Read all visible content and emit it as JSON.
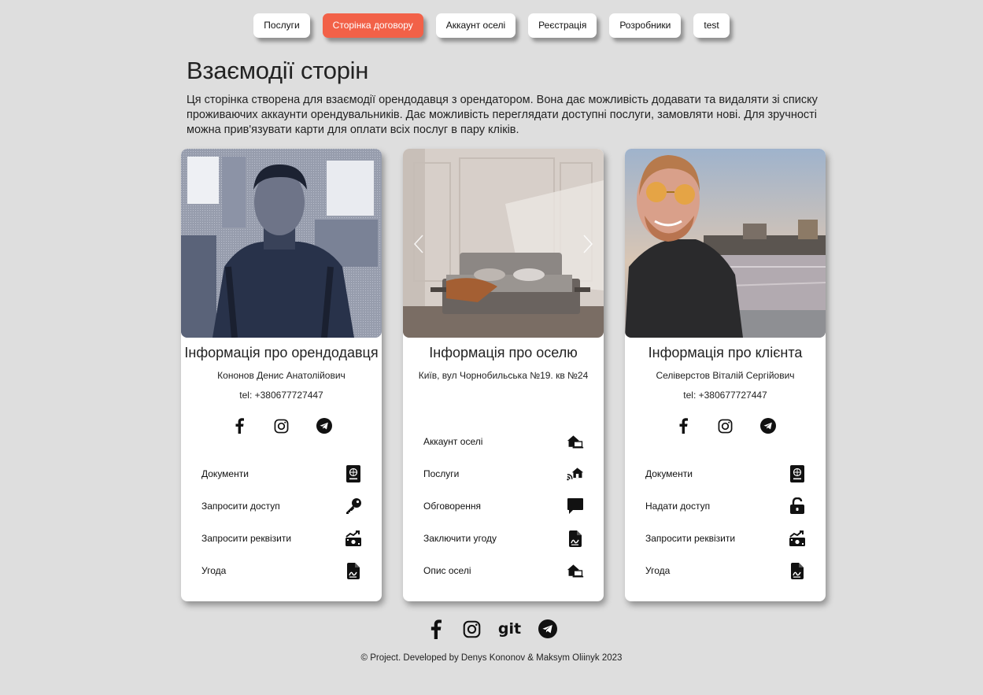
{
  "nav": {
    "items": [
      {
        "label": "Послуги"
      },
      {
        "label": "Сторінка договору"
      },
      {
        "label": "Аккаунт оселі"
      },
      {
        "label": "Реєстрація"
      },
      {
        "label": "Розробники"
      },
      {
        "label": "test"
      }
    ],
    "active_index": 1
  },
  "page": {
    "title": "Взаємодії сторін",
    "intro": "Ця сторінка створена для взаємодії орендодавця з орендатором. Вона дає можливість додавати та видаляти зі списку проживаючих аккаунти орендувальників. Дає можливість переглядати доступні послуги, замовляти нові. Для зручності можна прив'язувати карти для оплати всіх послуг в пару кліків."
  },
  "cards": {
    "landlord": {
      "title": "Інформація про орендодавця",
      "name": "Кононов Денис Анатолійович",
      "phone": "tel: +380677727447",
      "socials": [
        "facebook-icon",
        "instagram-icon",
        "telegram-icon"
      ],
      "actions": [
        {
          "label": "Документи",
          "icon": "passport-icon"
        },
        {
          "label": "Запросити доступ",
          "icon": "key-icon"
        },
        {
          "label": "Запросити реквізити",
          "icon": "money-trend-icon"
        },
        {
          "label": "Угода",
          "icon": "contract-file-icon"
        }
      ]
    },
    "home": {
      "title": "Інформація про оселю",
      "address": "Київ, вул Чорнобильська №19. кв №24",
      "actions": [
        {
          "label": "Аккаунт оселі",
          "icon": "house-laptop-icon"
        },
        {
          "label": "Послуги",
          "icon": "house-signal-icon"
        },
        {
          "label": "Обговорення",
          "icon": "comment-icon"
        },
        {
          "label": "Заключити угоду",
          "icon": "contract-file-icon"
        },
        {
          "label": "Опис оселі",
          "icon": "house-laptop-icon"
        }
      ]
    },
    "client": {
      "title": "Інформація про клієнта",
      "name": "Селіверстов Віталій Сергійович",
      "phone": "tel: +380677727447",
      "socials": [
        "facebook-icon",
        "instagram-icon",
        "telegram-icon"
      ],
      "actions": [
        {
          "label": "Документи",
          "icon": "passport-icon"
        },
        {
          "label": "Надати доступ",
          "icon": "unlock-icon"
        },
        {
          "label": "Запросити реквізити",
          "icon": "money-trend-icon"
        },
        {
          "label": "Угода",
          "icon": "contract-file-icon"
        }
      ]
    }
  },
  "footer": {
    "icons": [
      "facebook-icon",
      "instagram-icon",
      "git-icon",
      "telegram-icon"
    ],
    "git_label": "git",
    "copyright": "© Project. Developed by Denys Kononov & Maksym Oliinyk 2023"
  },
  "colors": {
    "background": "#dedede",
    "accent": "#f26148",
    "card": "#ffffff"
  }
}
